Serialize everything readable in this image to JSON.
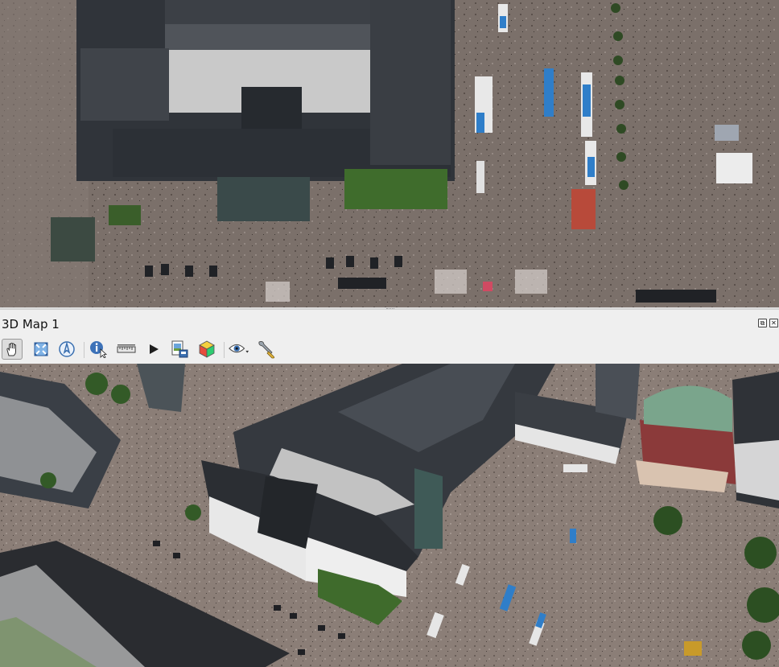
{
  "panel": {
    "title": "3D Map 1",
    "float_button_glyph": "⧉",
    "close_button_glyph": "✕"
  },
  "toolbar": {
    "tools": [
      {
        "name": "pan-hand-icon",
        "active": true
      },
      {
        "name": "zoom-full-icon",
        "active": false
      },
      {
        "name": "camera-north-icon",
        "active": false
      },
      {
        "name": "identify-icon",
        "active": false
      },
      {
        "name": "measure-line-icon",
        "active": false
      },
      {
        "name": "animation-play-icon",
        "active": false
      },
      {
        "name": "export-scene-icon",
        "active": false
      },
      {
        "name": "map-theme-cube-icon",
        "active": false
      },
      {
        "name": "view-eye-icon",
        "active": false
      },
      {
        "name": "configure-wrench-icon",
        "active": false
      }
    ]
  },
  "colors": {
    "roof_dark": "#2f3237",
    "roof_light": "#cfcfcf",
    "ground": "#7d726c",
    "green": "#3e6b2b",
    "accent_blue": "#2f7ec9"
  }
}
